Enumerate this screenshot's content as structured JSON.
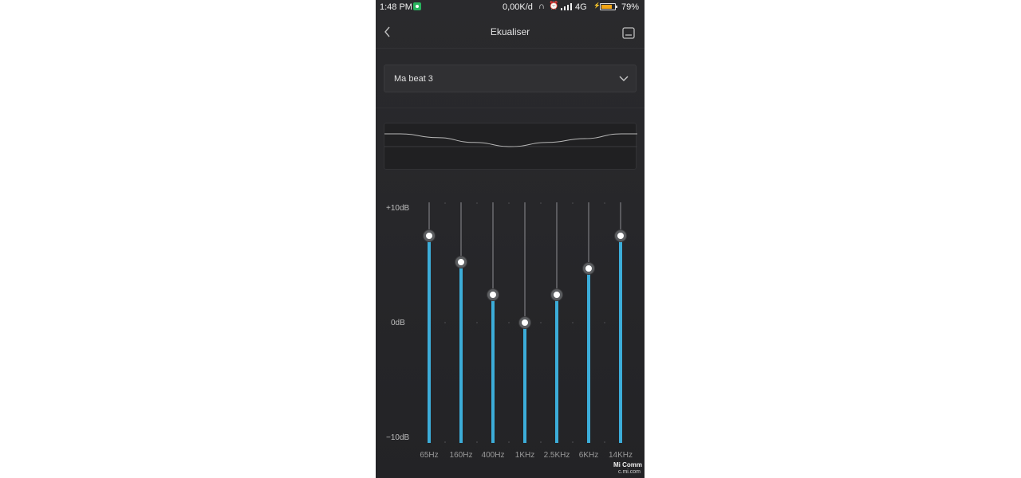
{
  "status_bar": {
    "time": "1:48 PM",
    "data_speed": "0,00K/d",
    "network": "4G",
    "battery_percent": "79%",
    "battery_level": 0.79,
    "icons": [
      "screen-record-icon",
      "headphone-icon",
      "alarm-icon",
      "signal-icon",
      "charging-icon",
      "battery-icon"
    ]
  },
  "header": {
    "title": "Ekualiser",
    "back_icon": "chevron-left-icon",
    "save_icon": "save-icon"
  },
  "preset": {
    "selected": "Ma beat 3",
    "icon": "chevron-down-icon"
  },
  "scale": {
    "top": "+10dB",
    "middle": "0dB",
    "bottom": "−10dB"
  },
  "bands": [
    {
      "freq": "65Hz",
      "level": 0.9
    },
    {
      "freq": "160Hz",
      "level": 0.78
    },
    {
      "freq": "400Hz",
      "level": 0.63
    },
    {
      "freq": "1KHz",
      "level": 0.5
    },
    {
      "freq": "2.5KHz",
      "level": 0.63
    },
    {
      "freq": "6KHz",
      "level": 0.75
    },
    {
      "freq": "14KHz",
      "level": 0.9
    }
  ],
  "colors": {
    "accent": "#3cadd9",
    "background": "#27272a",
    "battery": "#f2a516",
    "record": "#27b35d"
  },
  "watermark": {
    "line1": "Mi Comm",
    "line2": "c.mi.com"
  }
}
